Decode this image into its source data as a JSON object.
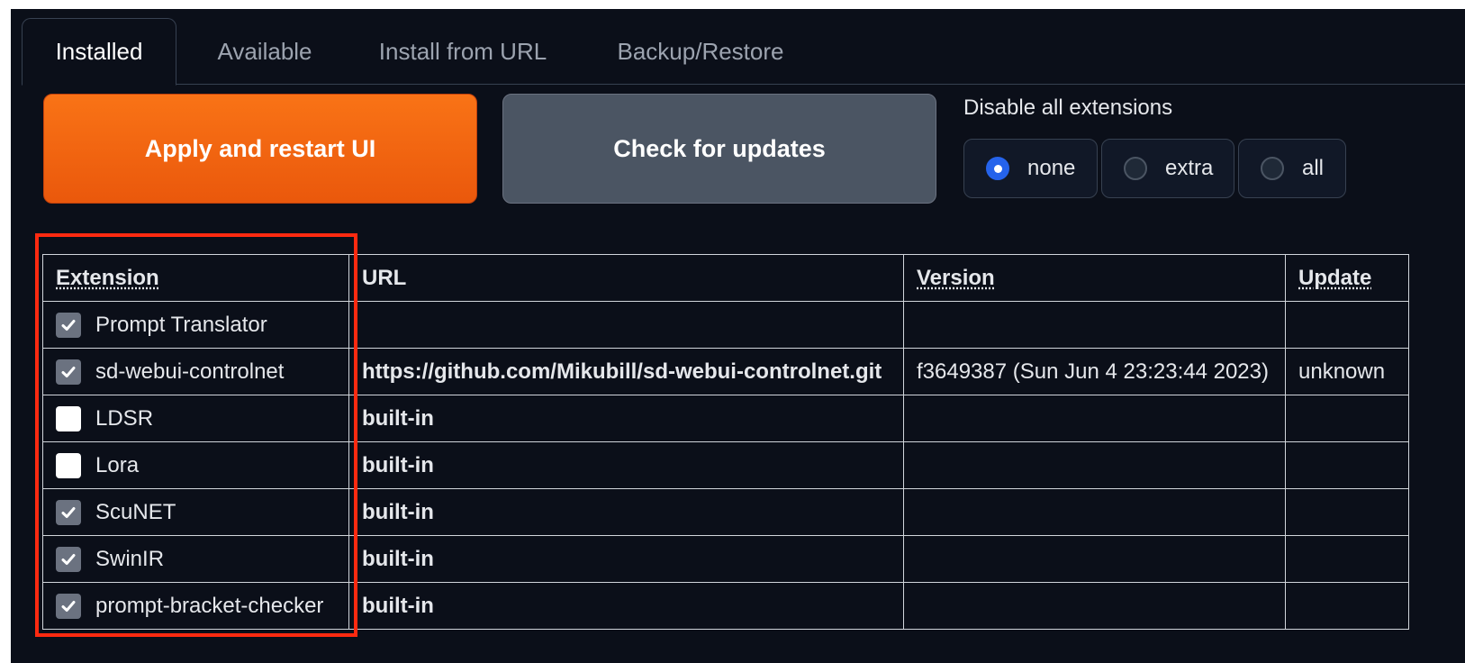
{
  "tabs": [
    "Installed",
    "Available",
    "Install from URL",
    "Backup/Restore"
  ],
  "active_tab": "Installed",
  "buttons": {
    "apply": "Apply and restart UI",
    "check": "Check for updates"
  },
  "disable": {
    "label": "Disable all extensions",
    "options": [
      "none",
      "extra",
      "all"
    ],
    "selected": "none"
  },
  "table": {
    "headers": [
      "Extension",
      "URL",
      "Version",
      "Update"
    ],
    "rows": [
      {
        "enabled": true,
        "name": "Prompt Translator",
        "url": "",
        "version": "",
        "update": ""
      },
      {
        "enabled": true,
        "name": "sd-webui-controlnet",
        "url": "https://github.com/Mikubill/sd-webui-controlnet.git",
        "version": "f3649387 (Sun Jun 4 23:23:44 2023)",
        "update": "unknown"
      },
      {
        "enabled": false,
        "name": "LDSR",
        "url": "built-in",
        "version": "",
        "update": ""
      },
      {
        "enabled": false,
        "name": "Lora",
        "url": "built-in",
        "version": "",
        "update": ""
      },
      {
        "enabled": true,
        "name": "ScuNET",
        "url": "built-in",
        "version": "",
        "update": ""
      },
      {
        "enabled": true,
        "name": "SwinIR",
        "url": "built-in",
        "version": "",
        "update": ""
      },
      {
        "enabled": true,
        "name": "prompt-bracket-checker",
        "url": "built-in",
        "version": "",
        "update": ""
      }
    ]
  },
  "colors": {
    "background": "#0b0f19",
    "apply_button": "#f97316",
    "check_button": "#4b5563",
    "radio_selected": "#2563eb",
    "highlight_box": "#ff2a10"
  }
}
